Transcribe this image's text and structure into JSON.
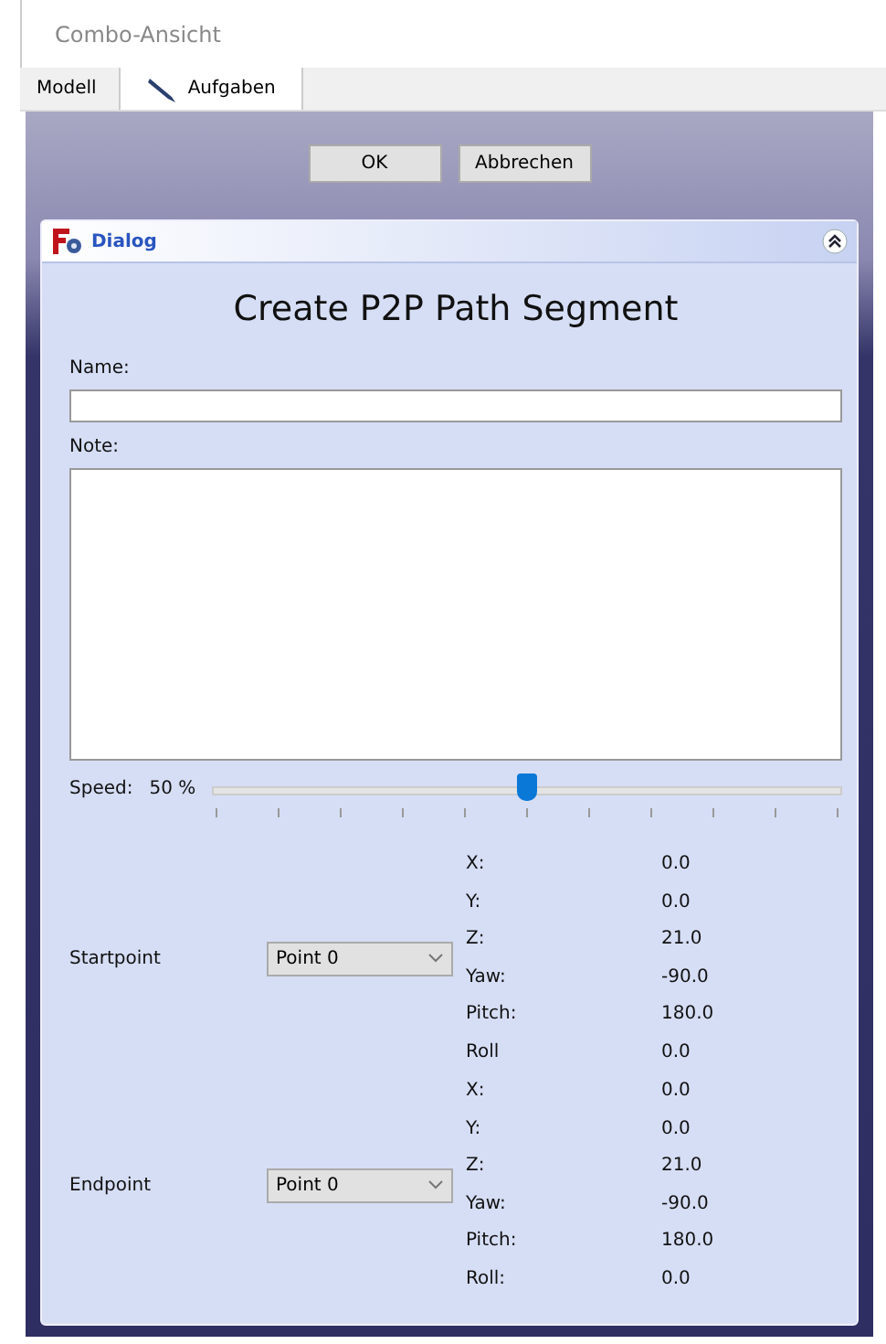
{
  "window": {
    "title": "Combo-Ansicht"
  },
  "tabs": [
    {
      "label": "Modell",
      "selected": false,
      "icon": false
    },
    {
      "label": "Aufgaben",
      "selected": true,
      "icon": true
    }
  ],
  "buttons": [
    "OK",
    "Abbrechen"
  ],
  "dialog": {
    "title": "Dialog",
    "heading": "Create P2P Path Segment",
    "name_label": "Name:",
    "note_label": "Note:",
    "speed": {
      "label": "Speed:",
      "reading": "50 %",
      "level": 0.5
    },
    "points": [
      {
        "label": "Startpoint",
        "dropdown": "Point 0",
        "coords": [
          {
            "label": "X:",
            "value": "0.0"
          },
          {
            "label": "Y:",
            "value": "0.0"
          },
          {
            "label": "Z:",
            "value": "21.0"
          },
          {
            "label": "Yaw:",
            "value": "-90.0"
          },
          {
            "label": "Pitch:",
            "value": "180.0"
          },
          {
            "label": "Roll",
            "value": "0.0"
          }
        ]
      },
      {
        "label": "Endpoint",
        "dropdown": "Point 0",
        "coords": [
          {
            "label": "X:",
            "value": "0.0"
          },
          {
            "label": "Y:",
            "value": "0.0"
          },
          {
            "label": "Z:",
            "value": "21.0"
          },
          {
            "label": "Yaw:",
            "value": "-90.0"
          },
          {
            "label": "Pitch:",
            "value": "180.0"
          },
          {
            "label": "Roll:",
            "value": "0.0"
          }
        ]
      }
    ]
  }
}
